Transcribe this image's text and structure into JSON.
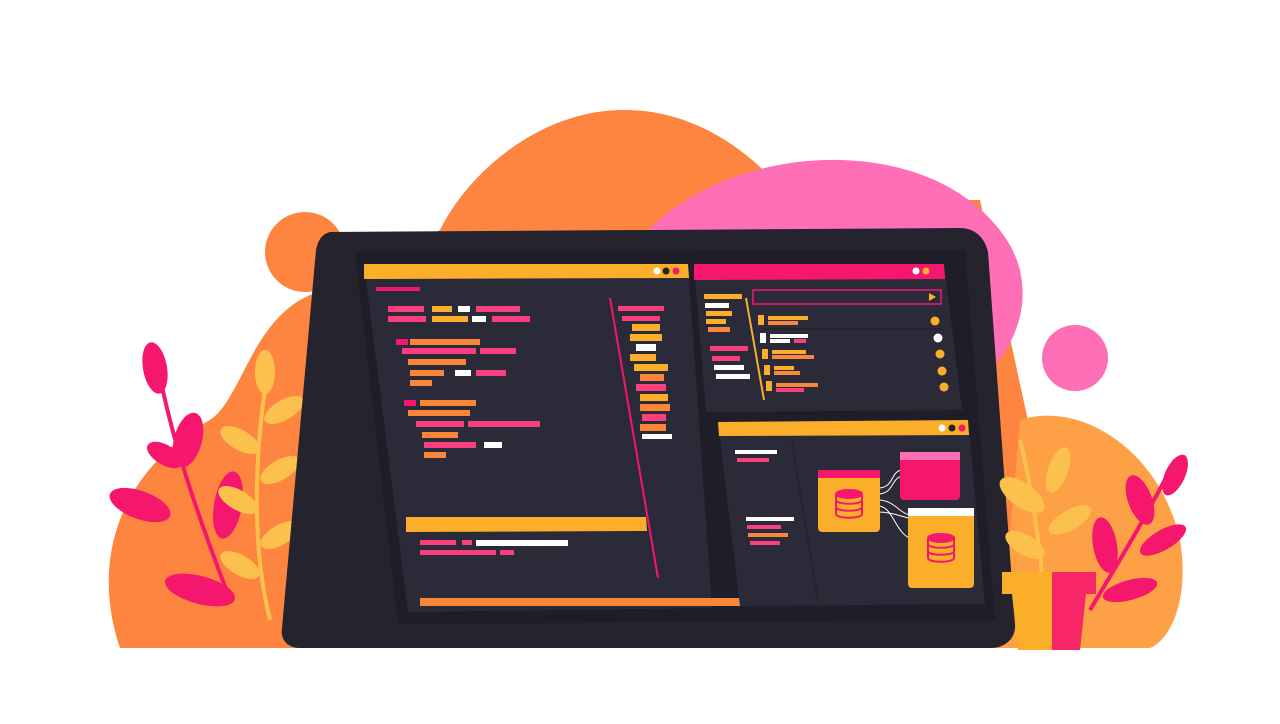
{
  "illustration": {
    "subject": "tablet-with-code-editor-and-database-panels",
    "colors": {
      "background": "#ffffff",
      "blob_orange": "#fd8540",
      "blob_orange_light": "#fda046",
      "blob_pink": "#ff6fb5",
      "accent_pink": "#f5176e",
      "accent_yellow": "#fbae2a",
      "leaf_yellow": "#fcc14c",
      "device_frame": "#24232e",
      "device_edge": "#323143",
      "screen_panel": "#2b2a38",
      "code_white": "#ffffff",
      "code_pink": "#f93f7e",
      "code_orange": "#fb8539"
    },
    "icons": {
      "window_dots": "window-controls-icon",
      "send": "send-arrow-icon",
      "check": "check-circle-icon",
      "database": "database-icon"
    },
    "task_items_checked": 5
  }
}
